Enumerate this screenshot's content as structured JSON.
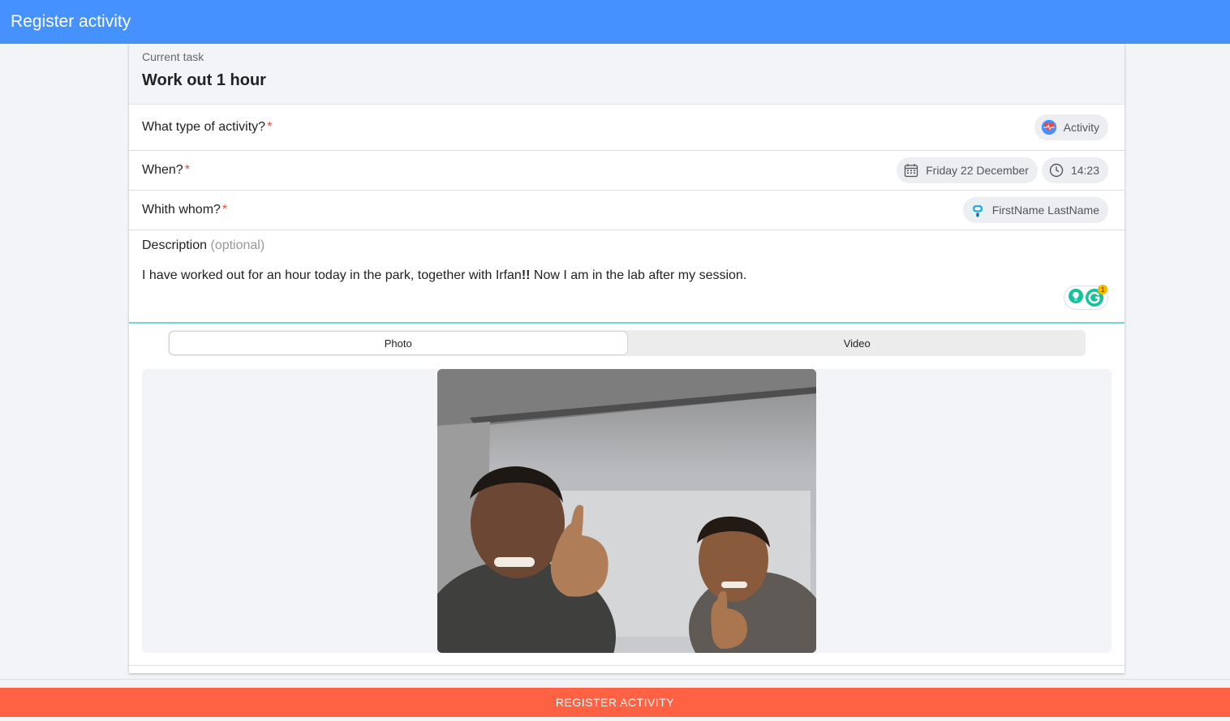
{
  "header": {
    "title": "Register activity"
  },
  "task": {
    "subtitle": "Current task",
    "title": "Work out 1 hour"
  },
  "fields": {
    "type": {
      "label": "What type of activity?",
      "required_mark": "*",
      "chip_label": "Activity",
      "chip_icon": "heart-activity-icon"
    },
    "when": {
      "label": "When?",
      "required_mark": "*",
      "date": "Friday 22 December",
      "time": "14:23",
      "date_icon": "calendar-icon",
      "time_icon": "clock-icon"
    },
    "whom": {
      "label": "Whith whom?",
      "required_mark": "*",
      "person": "FirstName LastName",
      "person_icon": "robot-avatar-icon"
    }
  },
  "description": {
    "label": "Description",
    "optional": "(optional)",
    "text_before": "I have worked out for an hour today in the park, together with Irfan",
    "text_bold": "!!",
    "text_after": " Now I am in the lab after my session.",
    "grammarly_badge": "1"
  },
  "media_tabs": [
    {
      "label": "Photo",
      "active": true
    },
    {
      "label": "Video",
      "active": false
    }
  ],
  "photo": {
    "description": "two men smiling with thumbs up"
  },
  "footer": {
    "button_label": "REGISTER ACTIVITY"
  },
  "colors": {
    "header": "#4592fe",
    "button": "#ff6143",
    "required": "#e74c3c",
    "accent_line": "#6edccb"
  }
}
